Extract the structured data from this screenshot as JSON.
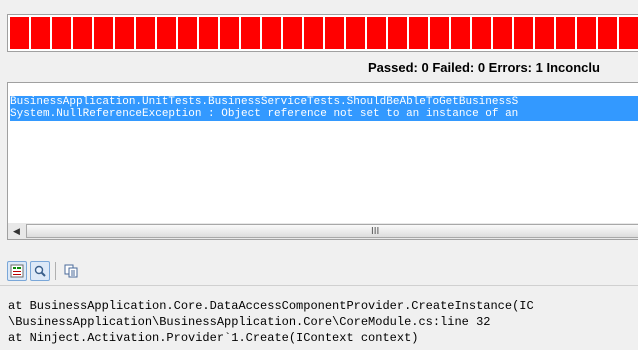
{
  "progress": {
    "status_color": "#ff0000",
    "fill_fraction": 1.0
  },
  "summary": {
    "text": "Passed: 0  Failed: 0  Errors: 1  Inconclu"
  },
  "results": {
    "lines": [
      "BusinessApplication.UnitTests.BusinessServiceTests.ShouldBeAbleToGetBusinessS",
      "System.NullReferenceException : Object reference not set to an instance of an"
    ]
  },
  "scrollbar": {
    "left_arrow": "◀",
    "grip": "III"
  },
  "toolbar": {
    "buttons": [
      {
        "icon": "text-report-icon",
        "active": true
      },
      {
        "icon": "magnifier-icon",
        "active": true
      },
      {
        "icon": "copy-icon",
        "active": false
      }
    ]
  },
  "stack_trace": {
    "lines": [
      "at BusinessApplication.Core.DataAccessComponentProvider.CreateInstance(IC",
      "\\BusinessApplication\\BusinessApplication.Core\\CoreModule.cs:line 32",
      "at Ninject.Activation.Provider`1.Create(IContext context)"
    ]
  }
}
